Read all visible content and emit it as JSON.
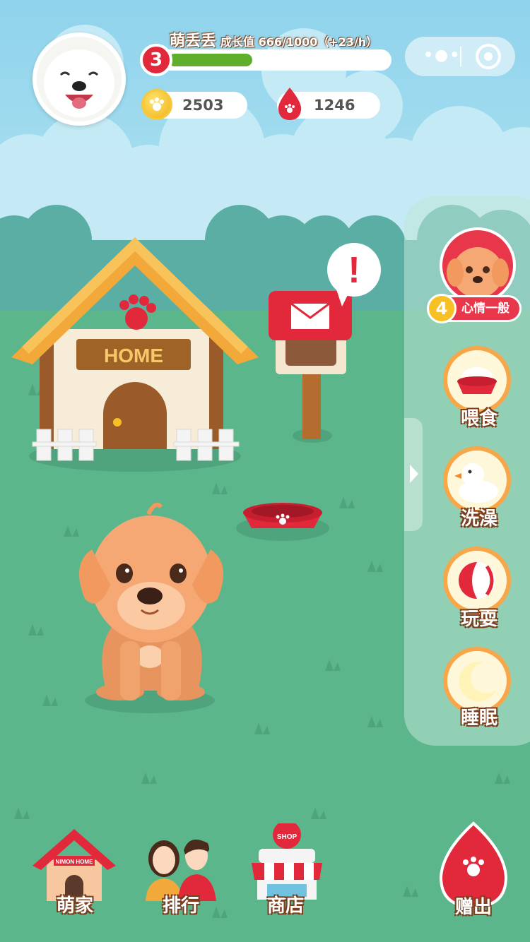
{
  "player": {
    "name": "萌丢丢",
    "growth_label": "成长值 666/1000（+23/h）",
    "level": "3",
    "growth_progress": 0.666,
    "coins": "2503",
    "gems": "1246"
  },
  "house": {
    "sign": "HOME"
  },
  "mailbox": {
    "alert": "!"
  },
  "mood": {
    "level": "4",
    "label": "心情一般"
  },
  "actions": [
    {
      "label": "喂食",
      "icon": "food-bowl-icon"
    },
    {
      "label": "洗澡",
      "icon": "rubber-duck-icon"
    },
    {
      "label": "玩耍",
      "icon": "ball-icon"
    },
    {
      "label": "睡眠",
      "icon": "moon-icon"
    }
  ],
  "nav": [
    {
      "label": "萌家",
      "icon": "doghouse-icon",
      "sub": "NIMON HOME"
    },
    {
      "label": "排行",
      "icon": "ranking-people-icon"
    },
    {
      "label": "商店",
      "icon": "shop-icon",
      "sub": "SHOP"
    },
    {
      "label": "赠出",
      "icon": "red-egg-icon"
    }
  ],
  "colors": {
    "sky": "#9fd8ec",
    "grass": "#5bb58c",
    "accent_red": "#e2293c",
    "xp_green": "#5fae2c",
    "ring_orange": "#f7a64a"
  }
}
